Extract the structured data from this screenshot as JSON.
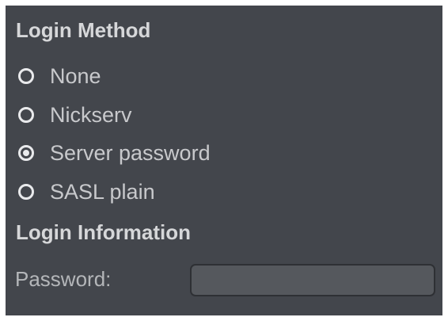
{
  "login_method": {
    "title": "Login Method",
    "options": [
      {
        "label": "None",
        "selected": false
      },
      {
        "label": "Nickserv",
        "selected": false
      },
      {
        "label": "Server password",
        "selected": true
      },
      {
        "label": "SASL plain",
        "selected": false
      }
    ]
  },
  "login_information": {
    "title": "Login Information",
    "password_label": "Password:",
    "password_value": "",
    "password_placeholder": ""
  },
  "colors": {
    "panel_background": "#43464c",
    "heading_text": "#d6d7d9",
    "option_text": "#c8c9cc",
    "radio_stroke": "#e9eaec",
    "input_background": "#55585d",
    "input_border": "#2e3034"
  }
}
